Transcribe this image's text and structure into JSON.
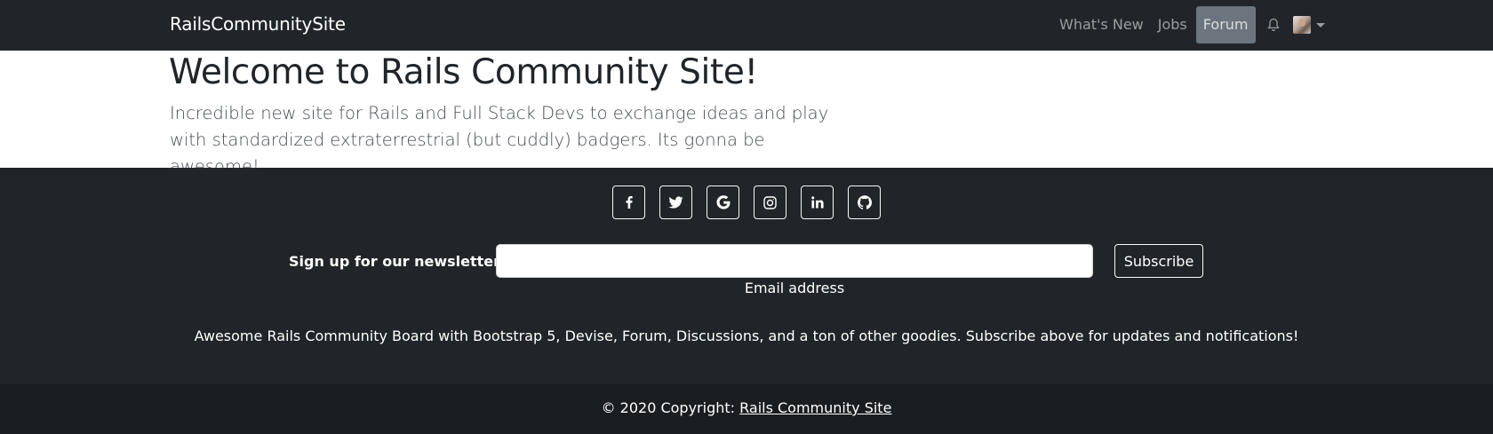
{
  "navbar": {
    "brand": "RailsCommunitySite",
    "links": [
      "What's New",
      "Jobs",
      "Forum"
    ],
    "active_link": "Forum",
    "icons": [
      "bell-icon",
      "avatar",
      "caret-down-icon"
    ]
  },
  "hero": {
    "title": "Welcome to Rails Community Site!",
    "lead": "Incredible new site for Rails and Full Stack Devs to exchange ideas and play with standardized extraterrestrial (but cuddly) badgers. Its gonna be awesome!"
  },
  "footer": {
    "social_icons": [
      "facebook-icon",
      "twitter-icon",
      "google-icon",
      "instagram-icon",
      "linkedin-icon",
      "github-icon"
    ],
    "newsletter_label": "Sign up for our newsletter",
    "email_value": "",
    "email_help": "Email address",
    "subscribe_label": "Subscribe",
    "blurb": "Awesome Rails Community Board with Bootstrap 5, Devise, Forum, Discussions, and a ton of other goodies. Subscribe above for updates and notifications!"
  },
  "copyright": {
    "prefix": "© 2020 Copyright: ",
    "link_text": "Rails Community Site"
  },
  "colors": {
    "navbar_bg": "#212529",
    "footer_bg": "#212529",
    "copyright_bg": "#1b1e21",
    "active_nav_bg": "#6c757d"
  }
}
